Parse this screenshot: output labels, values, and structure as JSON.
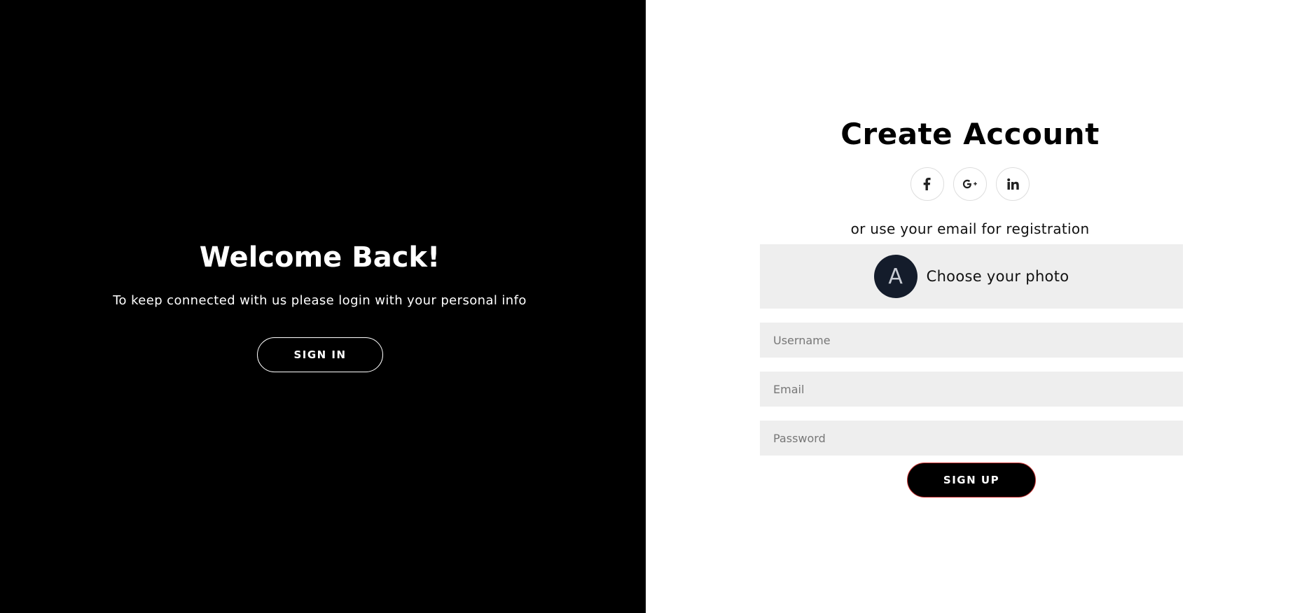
{
  "overlay": {
    "title": "Welcome Back!",
    "text": "To keep connected with us please login with your personal info",
    "sign_in_label": "SIGN IN"
  },
  "signup": {
    "title": "Create Account",
    "social": [
      {
        "icon": "facebook-icon",
        "glyph": "f"
      },
      {
        "icon": "google-plus-icon",
        "glyph": "G+"
      },
      {
        "icon": "linkedin-icon",
        "glyph": "in"
      }
    ],
    "alt_text": "or use your email for registration",
    "photo": {
      "avatar_letter": "A",
      "label": "Choose your photo"
    },
    "fields": {
      "username_placeholder": "Username",
      "email_placeholder": "Email",
      "password_placeholder": "Password"
    },
    "sign_up_label": "SIGN UP"
  },
  "colors": {
    "overlay_bg": "#000000",
    "field_bg": "#eeeeee",
    "avatar_bg": "#141c2b",
    "sign_up_border": "#cc3333"
  }
}
